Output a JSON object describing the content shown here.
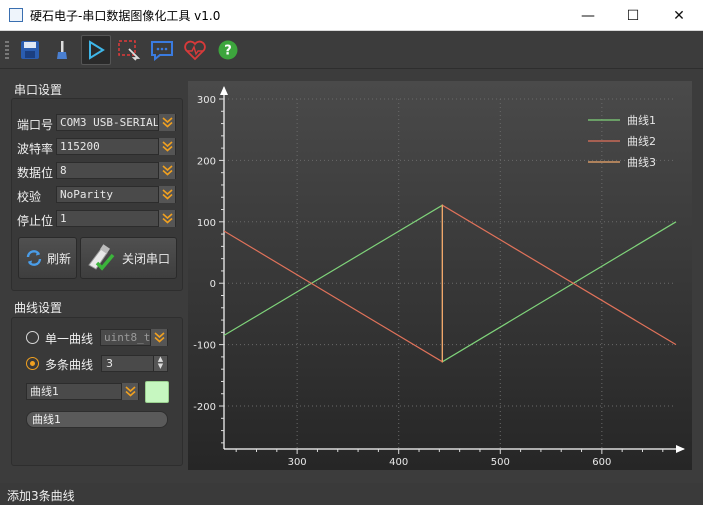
{
  "window": {
    "title": "硬石电子-串口数据图像化工具 v1.0",
    "min_glyph": "—",
    "max_glyph": "☐",
    "close_glyph": "✕"
  },
  "toolbar": {
    "icons": [
      "save-icon",
      "brush-icon",
      "play-icon",
      "select-icon",
      "comment-icon",
      "heartbeat-icon",
      "help-icon"
    ]
  },
  "serial": {
    "group_title": "串口设置",
    "port_label": "端口号",
    "port_value": "COM3 USB-SERIAL",
    "baud_label": "波特率",
    "baud_value": "115200",
    "databits_label": "数据位",
    "databits_value": "8",
    "parity_label": "校验",
    "parity_value": "NoParity",
    "stopbits_label": "停止位",
    "stopbits_value": "1",
    "refresh_label": "刷新",
    "close_port_label": "关闭串口"
  },
  "curve": {
    "group_title": "曲线设置",
    "single_label": "单一曲线",
    "single_type": "uint8_t",
    "multi_label": "多条曲线",
    "multi_count": "3",
    "selected_curve": "曲线1",
    "name_value": "曲线1",
    "color": "#c6f7c0"
  },
  "status": {
    "message": "添加3条曲线"
  },
  "colors": {
    "curve1": "#7fd37a",
    "curve2": "#e0725a",
    "curve3": "#f0a86c",
    "accent": "#f0a020"
  },
  "chart_data": {
    "type": "line",
    "title": "",
    "xlabel": "",
    "ylabel": "",
    "xlim": [
      228,
      673
    ],
    "ylim": [
      -270,
      300
    ],
    "x_ticks": [
      300,
      400,
      500,
      600
    ],
    "y_ticks": [
      300,
      200,
      100,
      0,
      -100,
      -200
    ],
    "grid": true,
    "legend_position": "top-right",
    "series": [
      {
        "name": "曲线1",
        "x": [
          228,
          443,
          443,
          673
        ],
        "y": [
          -85,
          127,
          -128,
          100
        ]
      },
      {
        "name": "曲线2",
        "x": [
          228,
          443,
          443,
          673
        ],
        "y": [
          85,
          -128,
          127,
          -100
        ]
      },
      {
        "name": "曲线3",
        "x": [
          443,
          443
        ],
        "y": [
          127,
          -128
        ]
      }
    ]
  }
}
